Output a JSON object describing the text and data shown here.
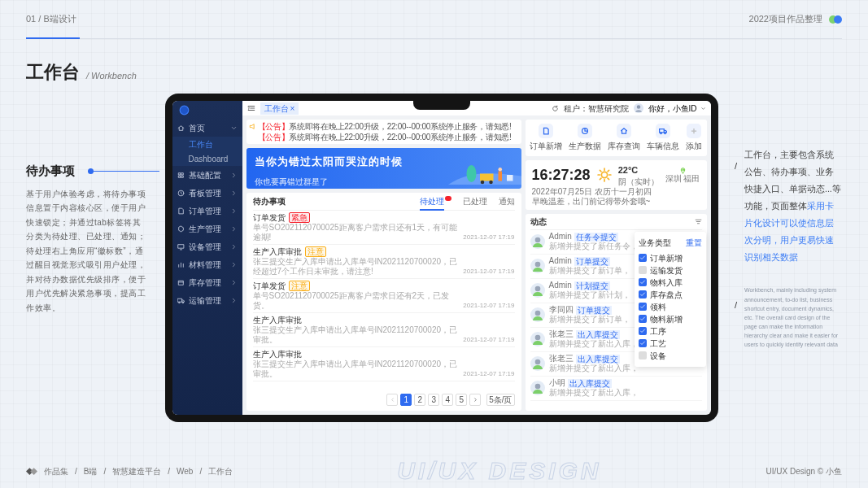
{
  "header": {
    "section": "01 / B端设计",
    "collection": "2022项目作品整理"
  },
  "page_title": {
    "title": "工作台",
    "subtitle": "/ Workbench"
  },
  "feature": {
    "title": "待办事项",
    "description": "基于用户体验考虑，将待办事项信息置于内容核心区，便于用户快速锁定；并通过tab标签将其分类为待处理、已处理、通知；待处理右上角应用“徽标数”，通过醒目视觉形式吸引用户处理，并对待办数据优先级排序，便于用户优先解决紧急事项，提高工作效率。"
  },
  "summary": {
    "marker": "/",
    "text": "工作台，主要包含系统公告、待办事项、业务快捷入口、单据动态...等功能，页面整体",
    "highlight": "采用卡片化设计可以使信息层次分明，用户更易快速识别相关数据",
    "english_marker": "/",
    "english": "Workbench, mainly including system announcement, to-do list, business shortcut entry, document dynamics, etc. The overall card design of the page can make the information hierarchy clear and make it easier for users to quickly identify relevant data"
  },
  "app": {
    "sidebar": {
      "items": [
        {
          "label": "首页",
          "expanded": true,
          "children": [
            {
              "label": "工作台",
              "selected": true
            },
            {
              "label": "Dashboard",
              "selected": false
            }
          ]
        },
        {
          "label": "基础配置",
          "expanded": false
        },
        {
          "label": "看板管理",
          "expanded": false
        },
        {
          "label": "订单管理",
          "expanded": false
        },
        {
          "label": "生产管理",
          "expanded": false
        },
        {
          "label": "设备管理",
          "expanded": false
        },
        {
          "label": "材料管理",
          "expanded": false
        },
        {
          "label": "库存管理",
          "expanded": false
        },
        {
          "label": "运输管理",
          "expanded": false
        }
      ]
    },
    "topbar": {
      "tabs": [
        {
          "label": "工作台",
          "close": "×",
          "selected": true
        }
      ],
      "tenant": "租户：智慧研究院",
      "greeting": "你好，小鱼ID"
    },
    "notices": [
      {
        "tag": "【公告】",
        "text": "系统即将在晚上22:00升级，22:00--00:00系统停止服务，请知悉!"
      },
      {
        "tag": "【公告】",
        "text": "系统即将在晚上22:00升级，22:00--00:00系统停止服务，请知悉!"
      }
    ],
    "banner": {
      "title": "当你为错过太阳而哭泣的时候",
      "subtitle": "你也要再错过群星了"
    },
    "todo": {
      "title": "待办事项",
      "tabs": [
        {
          "label": "待处理",
          "selected": true,
          "badge": true
        },
        {
          "label": "已处理",
          "selected": false
        },
        {
          "label": "通知",
          "selected": false
        }
      ],
      "items": [
        {
          "title": "订单发货",
          "tag": {
            "text": "紧急",
            "color": "#f5222d"
          },
          "description": "单号SO2021120700025距离客户需求日还有1天，有可能逾期!",
          "time": "2021-12-07 17:19"
        },
        {
          "title": "生产入库审批",
          "tag": {
            "text": "注意",
            "color": "#faad14"
          },
          "description": "张三提交生产入库申请出入库单号IN2021120700020，已经超过7个工作日未审批，请注意!",
          "time": "2021-12-07 17:19"
        },
        {
          "title": "订单发货",
          "tag": {
            "text": "注意",
            "color": "#faad14"
          },
          "description": "单号SO2021120700025距离客户需求日还有2天，已发货。",
          "time": "2021-12-07 17:19"
        },
        {
          "title": "生产入库审批",
          "description": "张三提交生产入库申请出入库单号IN2021120700020，已审批。",
          "time": "2021-12-07 17:19"
        },
        {
          "title": "生产入库审批",
          "description": "张三提交生产入库申请出入库单号IN2021120700020，已审批。",
          "time": "2021-12-07 17:19"
        }
      ],
      "pagination": {
        "pages": [
          {
            "label": "1",
            "selected": true
          },
          {
            "label": "2",
            "selected": false
          },
          {
            "label": "3",
            "selected": false
          },
          {
            "label": "4",
            "selected": false
          },
          {
            "label": "5",
            "selected": false
          }
        ],
        "page_size": "5条/页"
      }
    },
    "shortcuts": [
      {
        "label": "订单新增"
      },
      {
        "label": "生产数据"
      },
      {
        "label": "库存查询"
      },
      {
        "label": "车辆信息"
      },
      {
        "label": "添加"
      }
    ],
    "clock": {
      "time": "16:27:28",
      "date": "2022年07月25日 农历十一月初四",
      "temperature": "22°C",
      "weather": "阴（实时）",
      "location": "深圳 福田",
      "tip": "早晚温差，出门前记得带外套哦~"
    },
    "activity": {
      "title": "动态",
      "items": [
        {
          "name": "Admin",
          "tag": "任务令提交",
          "description": "新增并提交了新任务令，"
        },
        {
          "name": "Admin",
          "tag": "订单提交",
          "description": "新增并提交了新订单，"
        },
        {
          "name": "Admin",
          "tag": "计划提交",
          "description": "新增并提交了新计划，"
        },
        {
          "name": "李同四",
          "tag": "订单提交",
          "description": "新增并提交了新订单，"
        },
        {
          "name": "张老三",
          "tag": "出入库提交",
          "description": "新增并提交了新出入库，"
        },
        {
          "name": "张老三",
          "tag": "出入库提交",
          "description": "新增并提交了新出入库，"
        },
        {
          "name": "小明",
          "tag": "出入库提交",
          "description": "新增并提交了新出入库，"
        }
      ],
      "filter": {
        "title": "业务类型",
        "reset": "重置",
        "options": [
          {
            "label": "订单新增",
            "checked": true
          },
          {
            "label": "运输发货",
            "checked": false
          },
          {
            "label": "物料入库",
            "checked": true
          },
          {
            "label": "库存盘点",
            "checked": true
          },
          {
            "label": "领料",
            "checked": true
          },
          {
            "label": "物料新增",
            "checked": true
          },
          {
            "label": "工序",
            "checked": true
          },
          {
            "label": "工艺",
            "checked": true
          },
          {
            "label": "设备",
            "checked": false
          }
        ]
      }
    }
  },
  "footer": {
    "breadcrumb": [
      "作品集",
      "B端",
      "智慧建造平台",
      "Web",
      "工作台"
    ],
    "separator": "/",
    "slogan": "UI/UX DESIGN",
    "credit": "UI/UX Design © 小鱼"
  }
}
